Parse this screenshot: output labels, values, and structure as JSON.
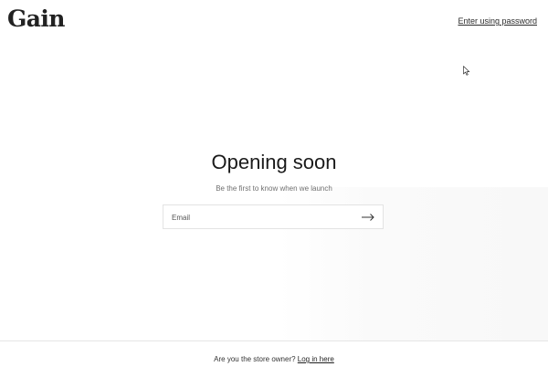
{
  "header": {
    "logo_text": "Gain",
    "password_link": "Enter using password"
  },
  "main": {
    "title": "Opening soon",
    "subtitle": "Be the first to know when we launch",
    "email_placeholder": "Email",
    "submit_icon": "arrow-right-icon"
  },
  "footer": {
    "prompt": "Are you the store owner?",
    "login_link": "Log in here"
  },
  "colors": {
    "text": "#1f1f1f",
    "muted": "#6f6f6f",
    "border": "#e3e3e3",
    "background": "#ffffff"
  }
}
